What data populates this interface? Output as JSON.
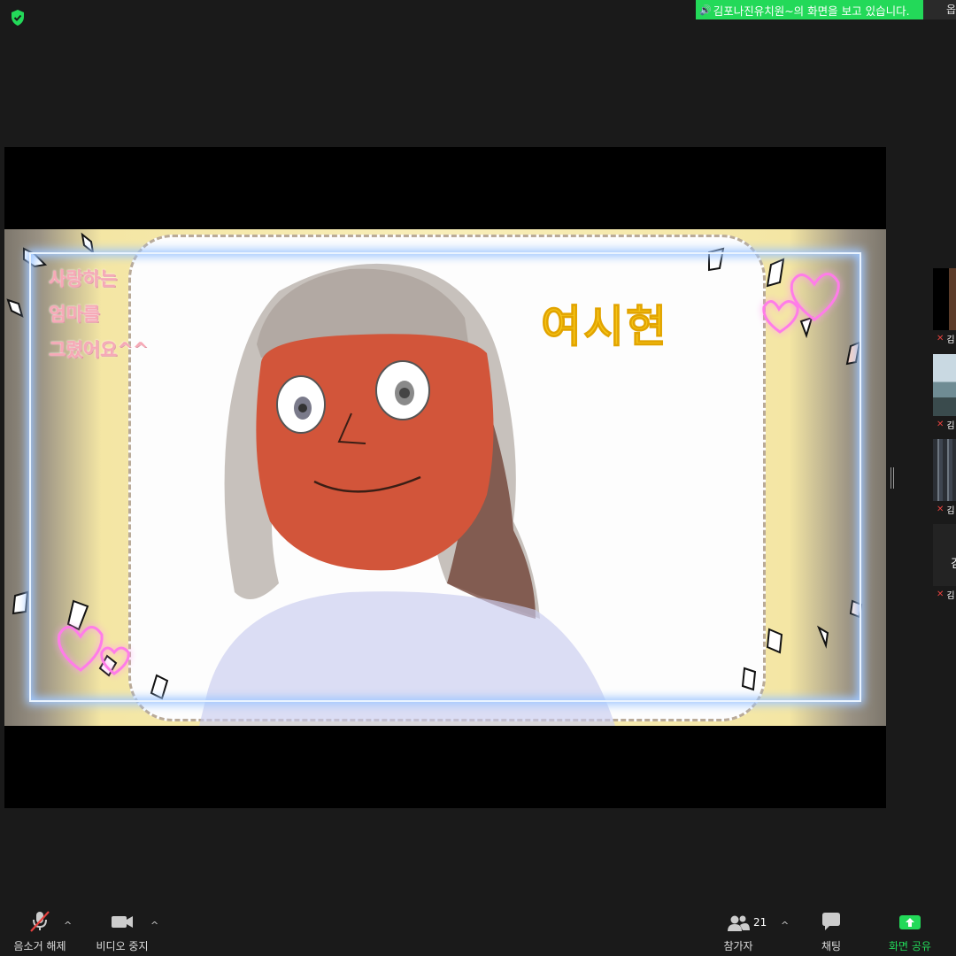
{
  "banner": {
    "viewing_text": "김포나진유치원~의 화면을 보고 있습니다.",
    "view_options": "옵"
  },
  "slide": {
    "caption_lines": [
      "사랑하는",
      "엄마를",
      "그렸어요^^"
    ],
    "child_name": "여시현"
  },
  "participants_panel": {
    "tiles": [
      {
        "name": "김"
      },
      {
        "name": "김"
      },
      {
        "name": "김"
      },
      {
        "name": "김",
        "center_text": "김"
      }
    ]
  },
  "toolbar": {
    "unmute_label": "음소거 해제",
    "stop_video_label": "비디오 중지",
    "participants_label": "참가자",
    "participants_count": "21",
    "chat_label": "채팅",
    "share_screen_label": "화면 공유"
  },
  "colors": {
    "banner_green": "#23d959",
    "share_green": "#23d959",
    "mic_muted_red": "#e5413e",
    "name_yellow": "#f5c518",
    "caption_pink": "#f7a9b6"
  }
}
